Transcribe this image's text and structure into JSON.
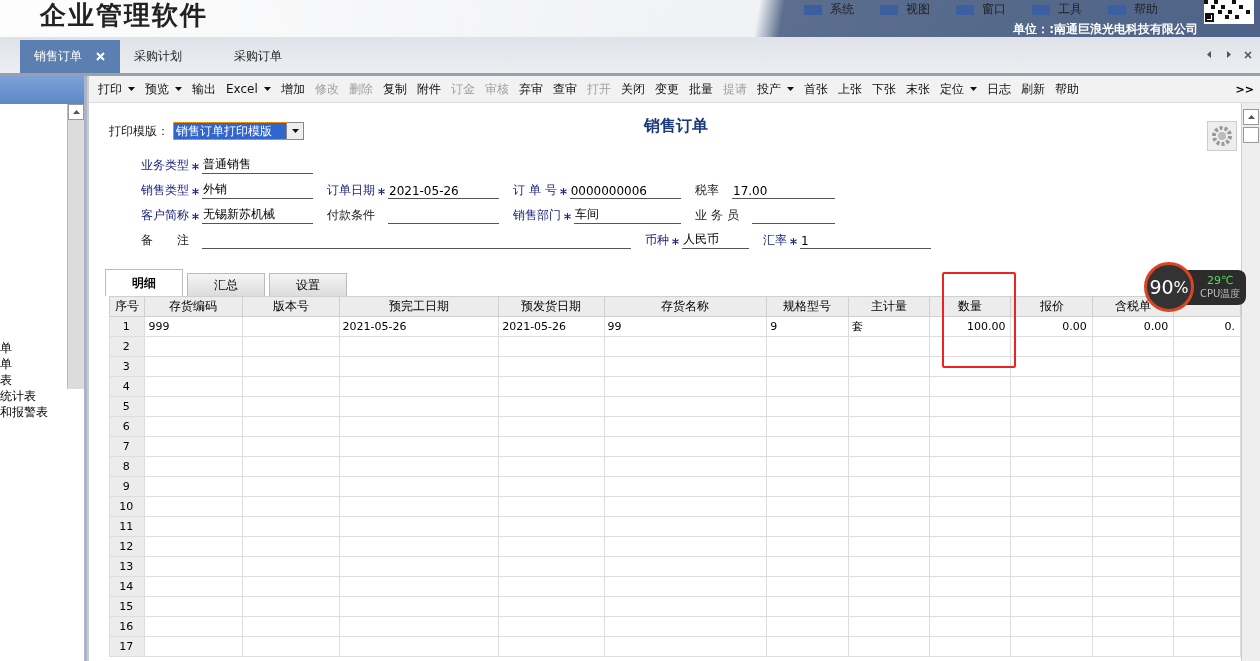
{
  "app": {
    "title": "企业管理软件",
    "menu": [
      "系统",
      "视图",
      "窗口",
      "工具",
      "帮助"
    ],
    "company": "单位：:南通巨浪光电科技有限公司"
  },
  "doc_tabs": [
    {
      "label": "销售订单",
      "selected": true,
      "closable": true
    },
    {
      "label": "采购计划",
      "selected": false,
      "closable": false
    },
    {
      "label": "采购订单",
      "selected": false,
      "closable": false
    }
  ],
  "sidebar": {
    "items": [
      "单",
      "单",
      "表",
      "统计表",
      "和报警表"
    ]
  },
  "toolbar": [
    {
      "label": "打印",
      "dropdown": true,
      "disabled": false
    },
    {
      "label": "预览",
      "dropdown": true,
      "disabled": false
    },
    {
      "label": "输出",
      "dropdown": false,
      "disabled": false
    },
    {
      "label": "Excel",
      "dropdown": true,
      "disabled": false
    },
    {
      "label": "增加",
      "dropdown": false,
      "disabled": false
    },
    {
      "label": "修改",
      "dropdown": false,
      "disabled": true
    },
    {
      "label": "删除",
      "dropdown": false,
      "disabled": true
    },
    {
      "label": "复制",
      "dropdown": false,
      "disabled": false
    },
    {
      "label": "附件",
      "dropdown": false,
      "disabled": false
    },
    {
      "label": "订金",
      "dropdown": false,
      "disabled": true
    },
    {
      "label": "审核",
      "dropdown": false,
      "disabled": true
    },
    {
      "label": "弃审",
      "dropdown": false,
      "disabled": false
    },
    {
      "label": "查审",
      "dropdown": false,
      "disabled": false
    },
    {
      "label": "打开",
      "dropdown": false,
      "disabled": true
    },
    {
      "label": "关闭",
      "dropdown": false,
      "disabled": false
    },
    {
      "label": "变更",
      "dropdown": false,
      "disabled": false
    },
    {
      "label": "批量",
      "dropdown": false,
      "disabled": false
    },
    {
      "label": "提请",
      "dropdown": false,
      "disabled": true
    },
    {
      "label": "投产",
      "dropdown": true,
      "disabled": false
    },
    {
      "label": "首张",
      "dropdown": false,
      "disabled": false
    },
    {
      "label": "上张",
      "dropdown": false,
      "disabled": false
    },
    {
      "label": "下张",
      "dropdown": false,
      "disabled": false
    },
    {
      "label": "末张",
      "dropdown": false,
      "disabled": false
    },
    {
      "label": "定位",
      "dropdown": true,
      "disabled": false
    },
    {
      "label": "日志",
      "dropdown": false,
      "disabled": false
    },
    {
      "label": "刷新",
      "dropdown": false,
      "disabled": false
    },
    {
      "label": "帮助",
      "dropdown": false,
      "disabled": false
    }
  ],
  "toolbar_more": ">>",
  "form": {
    "template_label": "打印模版：",
    "template_value": "销售订单打印模版",
    "title": "销售订单",
    "rows": [
      [
        {
          "label": "业务类型",
          "required": true,
          "value": "普通销售"
        }
      ],
      [
        {
          "label": "销售类型",
          "required": true,
          "value": "外销"
        },
        {
          "label": "订单日期",
          "required": true,
          "value": "2021-05-26"
        },
        {
          "label": "订 单 号",
          "required": true,
          "value": "0000000006"
        },
        {
          "label": "税率",
          "required": false,
          "value": "17.00"
        }
      ],
      [
        {
          "label": "客户简称",
          "required": true,
          "value": "无锡新苏机械"
        },
        {
          "label": "付款条件",
          "required": false
        },
        {
          "label": "销售部门",
          "required": true,
          "value": "车间"
        },
        {
          "label": "业 务 员",
          "required": false
        }
      ],
      [
        {
          "label": "备　　注",
          "required": false,
          "wide": true
        },
        {
          "label": "币种",
          "required": true,
          "value": "人民币"
        },
        {
          "label": "汇率",
          "required": true,
          "value": "1"
        }
      ]
    ]
  },
  "detail_tabs": [
    {
      "label": "明细",
      "selected": true
    },
    {
      "label": "汇总",
      "selected": false
    },
    {
      "label": "设置",
      "selected": false
    }
  ],
  "table": {
    "columns": [
      "序号",
      "存货编码",
      "版本号",
      "预完工日期",
      "预发货日期",
      "存货名称",
      "规格型号",
      "主计量",
      "数量",
      "报价",
      "含税单",
      ""
    ],
    "rows": [
      [
        "1",
        "999",
        "",
        "2021-05-26",
        "2021-05-26",
        "99",
        "9",
        "套",
        "100.00",
        "0.00",
        "0.00",
        "0."
      ],
      [
        "2"
      ],
      [
        "3"
      ],
      [
        "4"
      ],
      [
        "5"
      ],
      [
        "6"
      ],
      [
        "7"
      ],
      [
        "8"
      ],
      [
        "9"
      ],
      [
        "10"
      ],
      [
        "11"
      ],
      [
        "12"
      ],
      [
        "13"
      ],
      [
        "14"
      ],
      [
        "15"
      ],
      [
        "16"
      ],
      [
        "17"
      ]
    ]
  },
  "cpu_widget": {
    "usage": "90",
    "unit": "%",
    "temp": "29℃",
    "label": "CPU温度"
  }
}
